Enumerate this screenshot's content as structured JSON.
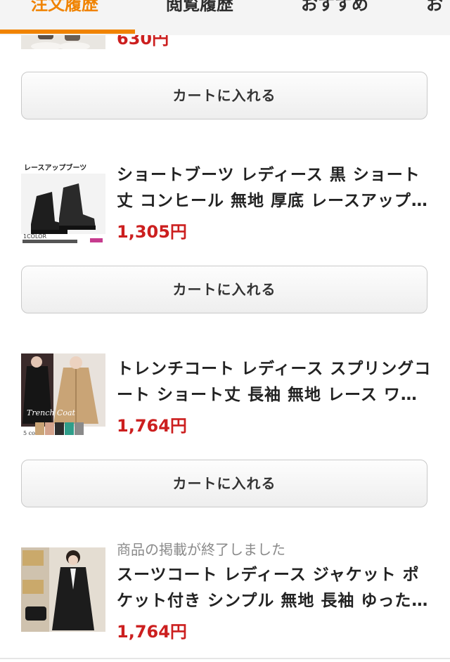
{
  "tabs": [
    {
      "label": "注文履歴",
      "active": true
    },
    {
      "label": "閲覧履歴",
      "active": false
    },
    {
      "label": "おすすめ",
      "active": false
    },
    {
      "label": "お",
      "active": false
    }
  ],
  "colors": {
    "accent": "#f08300",
    "price": "#cc1f1f",
    "ended_text": "#8a8a8a"
  },
  "items": [
    {
      "price": "630円",
      "cart_button": "カートに入れる"
    },
    {
      "title_line1": "ショートブーツ レディース 黒 ショート",
      "title_line2": "丈 コンヒール 無地 厚底 レースアップ…",
      "price": "1,305円",
      "thumb_text": "レースアップブーツ",
      "thumb_color_label": "1COLOR",
      "cart_button": "カートに入れる"
    },
    {
      "title_line1": "トレンチコート レディース スプリングコ",
      "title_line2": "ート ショート丈 長袖 無地 レース ワン…",
      "price": "1,764円",
      "thumb_text": "Trench Coat",
      "thumb_color_label": "5 color",
      "cart_button": "カートに入れる"
    },
    {
      "status": "商品の掲載が終了しました",
      "title_line1": "スーツコート レディース ジャケット ポ",
      "title_line2": "ケット付き シンプル 無地 長袖 ゆった…",
      "price": "1,764円"
    }
  ]
}
